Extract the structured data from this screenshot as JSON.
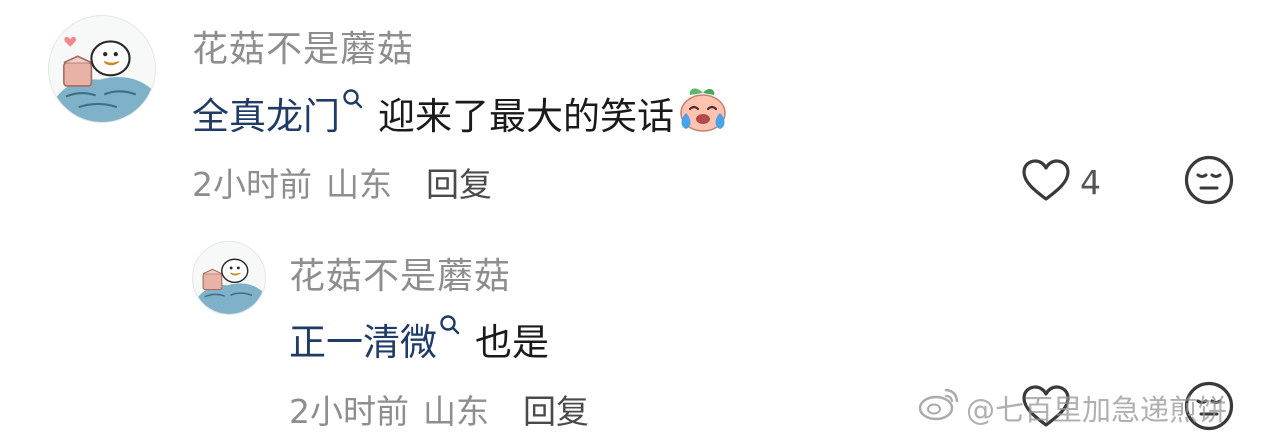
{
  "comments": [
    {
      "username": "花菇不是蘑菇",
      "topic": "全真龙门",
      "text": "迎来了最大的笑话",
      "emoji_icon": "crying-peach-emoji-icon",
      "time": "2小时前",
      "location": "山东",
      "reply_label": "回复",
      "like_count": "4"
    },
    {
      "username": "花菇不是蘑菇",
      "topic": "正一清微",
      "text": "也是",
      "time": "2小时前",
      "location": "山东",
      "reply_label": "回复"
    }
  ],
  "watermark": {
    "text": "@七百里加急递煎饼",
    "icon": "weibo-logo-icon"
  },
  "colors": {
    "username": "#8e8e8e",
    "topic_link": "#1f3b66",
    "text": "#1a1a1a",
    "meta": "#8e8e8e",
    "reply": "#4a4a4a"
  }
}
